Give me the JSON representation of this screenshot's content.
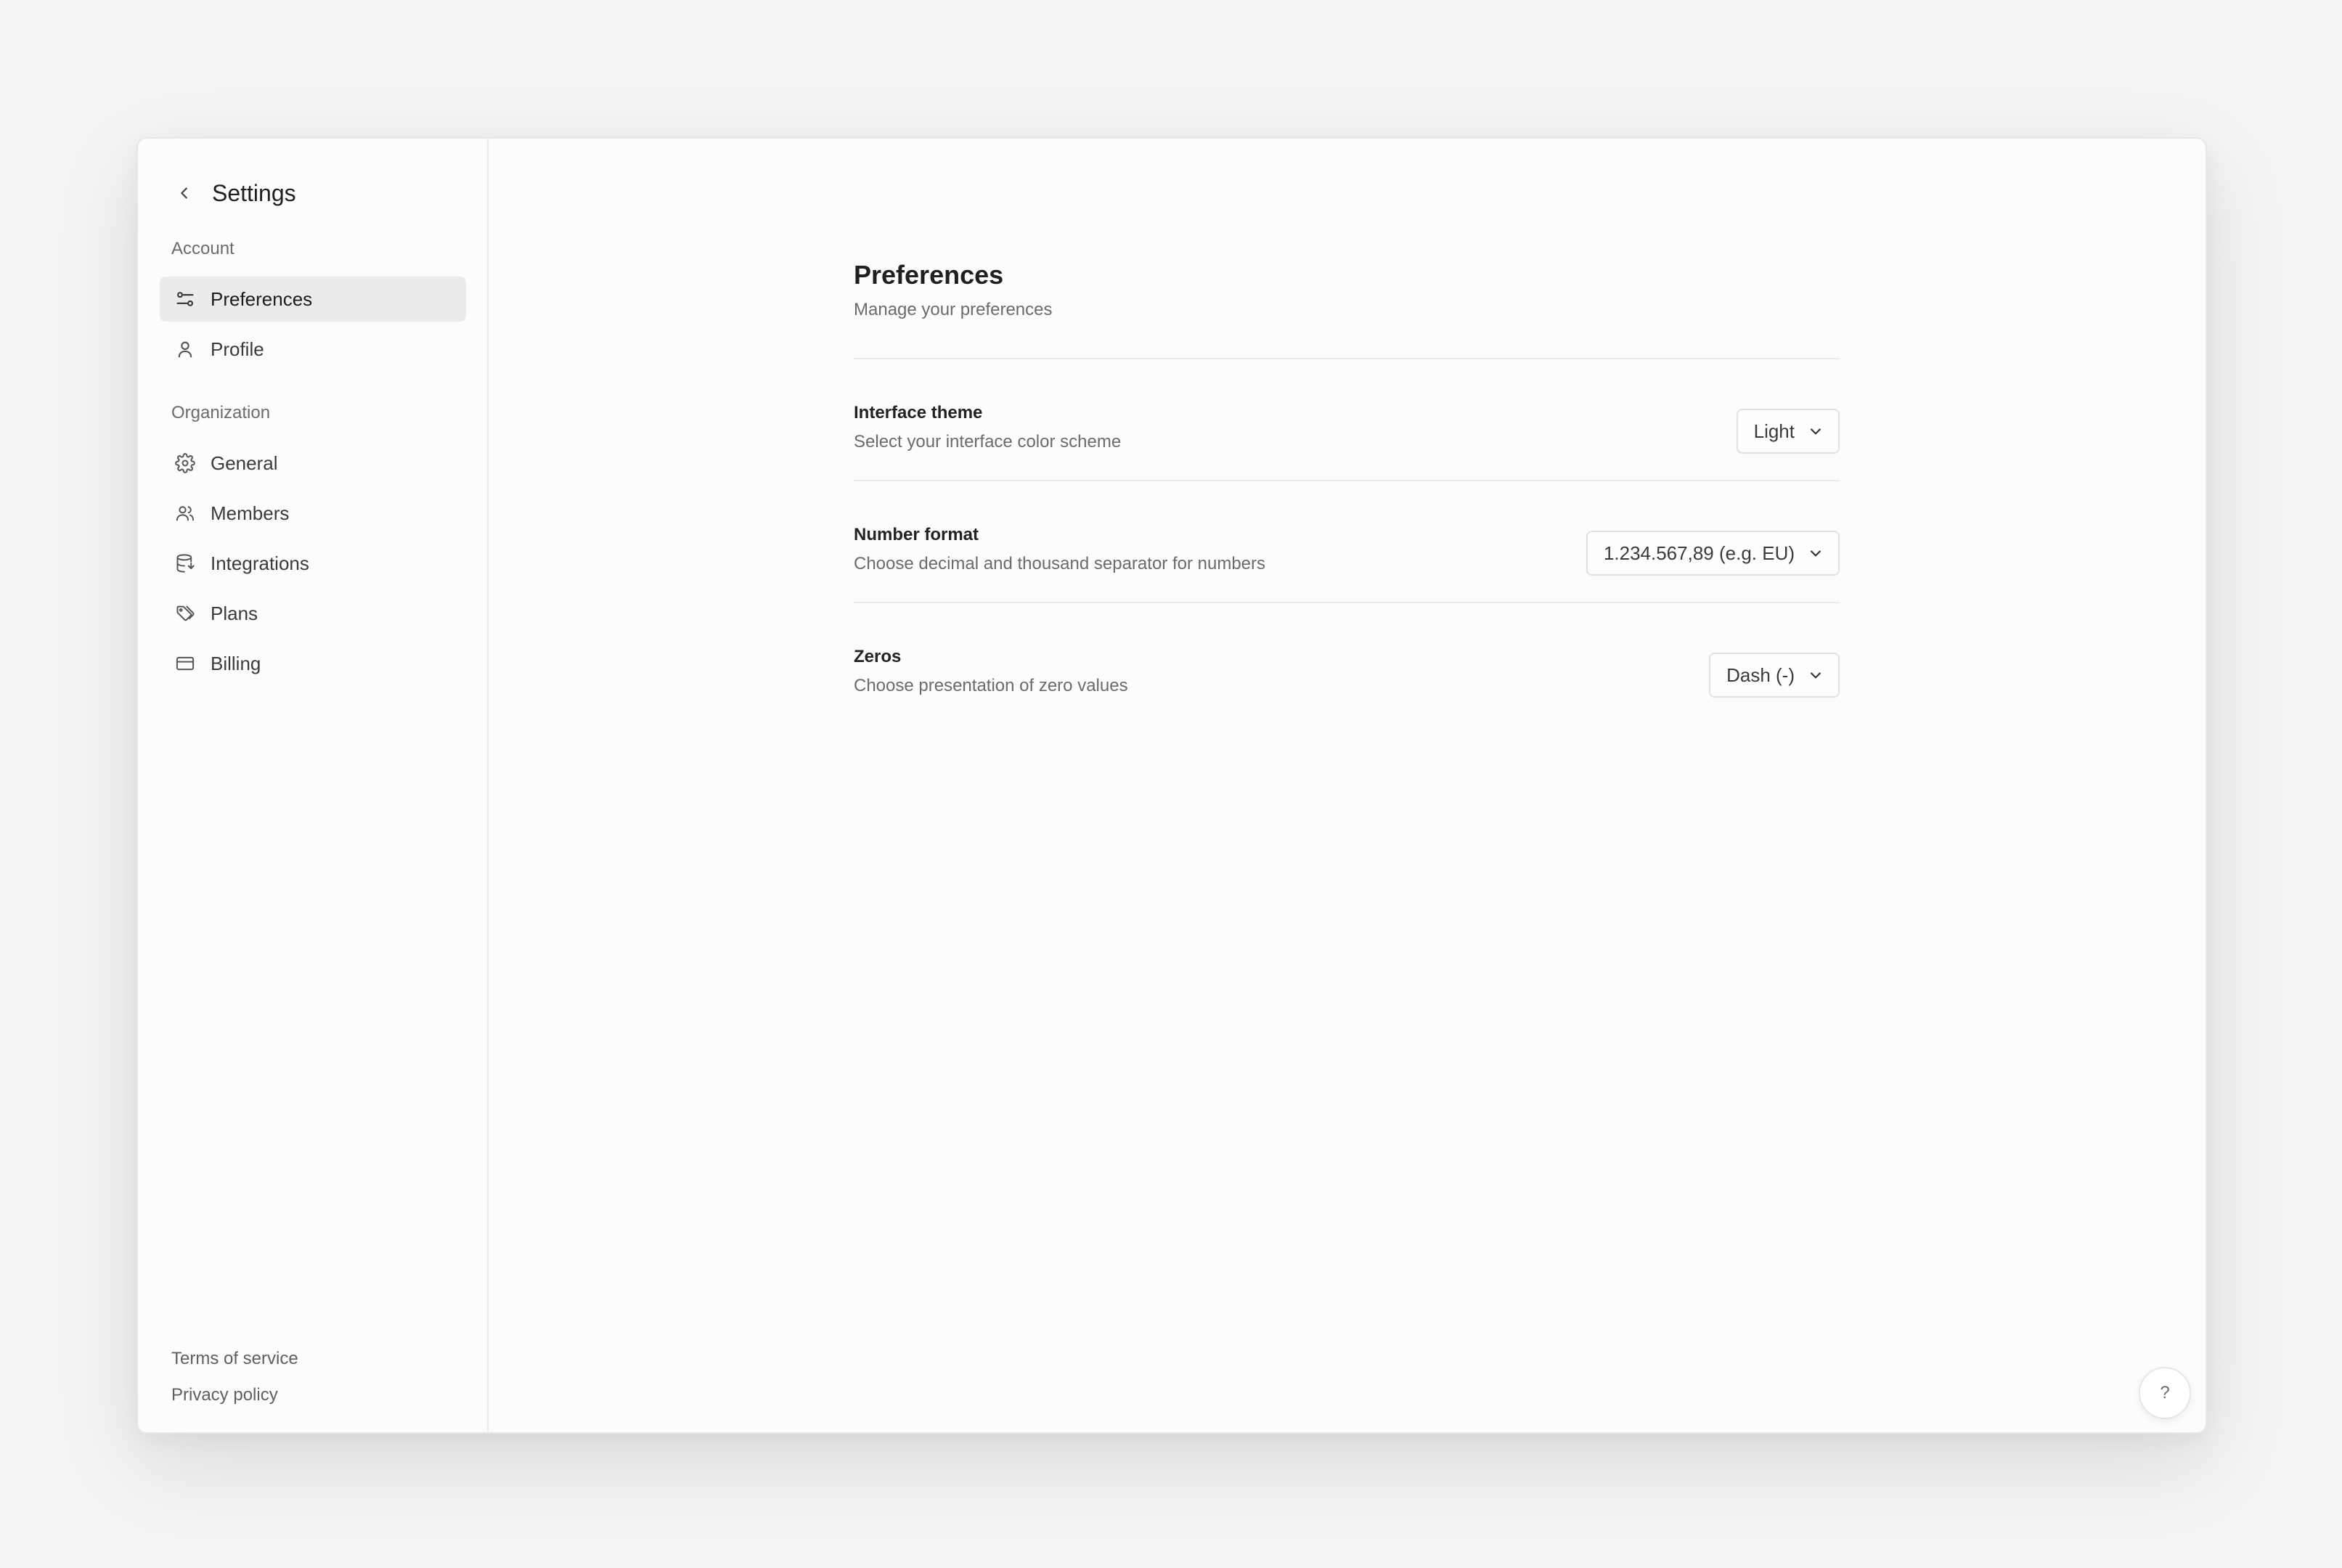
{
  "sidebar": {
    "title": "Settings",
    "back_icon": "chevron-left-icon",
    "sections": [
      {
        "label": "Account",
        "items": [
          {
            "label": "Preferences",
            "icon": "sliders-icon",
            "active": true
          },
          {
            "label": "Profile",
            "icon": "user-icon",
            "active": false
          }
        ]
      },
      {
        "label": "Organization",
        "items": [
          {
            "label": "General",
            "icon": "gear-icon",
            "active": false
          },
          {
            "label": "Members",
            "icon": "users-icon",
            "active": false
          },
          {
            "label": "Integrations",
            "icon": "database-icon",
            "active": false
          },
          {
            "label": "Plans",
            "icon": "tags-icon",
            "active": false
          },
          {
            "label": "Billing",
            "icon": "credit-card-icon",
            "active": false
          }
        ]
      }
    ],
    "footer": {
      "terms": "Terms of service",
      "privacy": "Privacy policy"
    }
  },
  "main": {
    "title": "Preferences",
    "subtitle": "Manage your preferences",
    "rows": [
      {
        "label": "Interface theme",
        "description": "Select your interface color scheme",
        "value": "Light"
      },
      {
        "label": "Number format",
        "description": "Choose decimal and thousand separator for numbers",
        "value": "1.234.567,89 (e.g. EU)"
      },
      {
        "label": "Zeros",
        "description": "Choose presentation of zero values",
        "value": "Dash (-)"
      }
    ]
  },
  "help": {
    "label": "?"
  },
  "colors": {
    "background": "#f4f4f4",
    "panel": "#fcfcfc",
    "active_item": "#ebebeb",
    "divider": "#ececec"
  }
}
